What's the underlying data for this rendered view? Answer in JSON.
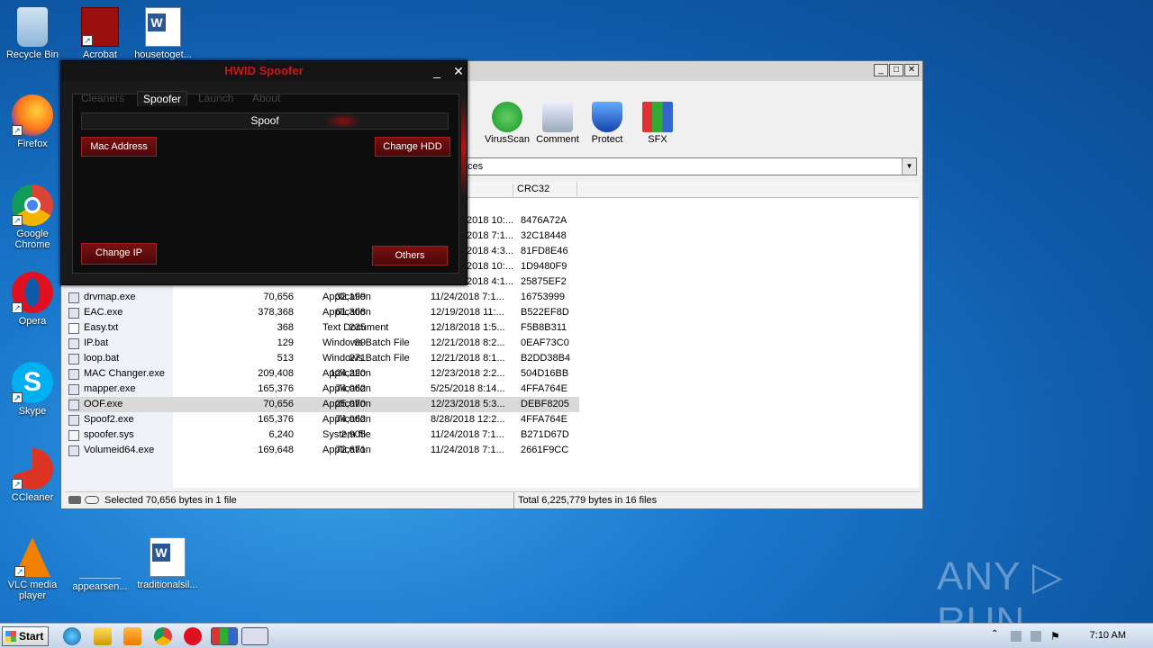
{
  "desktop": {
    "icons": [
      {
        "label": "Recycle Bin"
      },
      {
        "label": "Acrobat"
      },
      {
        "label": "housetoget..."
      },
      {
        "label": "Firefox"
      },
      {
        "label": "Google Chrome"
      },
      {
        "label": "Opera"
      },
      {
        "label": "Skype"
      },
      {
        "label": "CCleaner"
      },
      {
        "label": "VLC media player"
      },
      {
        "label": "appearsen..."
      },
      {
        "label": "traditionalsil..."
      }
    ]
  },
  "winrar": {
    "toolbar": [
      "VirusScan",
      "Comment",
      "Protect",
      "SFX"
    ],
    "path_value": "ces",
    "columns": {
      "crc": "CRC32"
    },
    "partial_rows": [
      {
        "modified": "2018 10:...",
        "crc": "8476A72A"
      },
      {
        "modified": "2018 7:1...",
        "crc": "32C18448"
      },
      {
        "modified": "2018 4:3...",
        "crc": "81FD8E46"
      },
      {
        "modified": "2018 10:...",
        "crc": "1D9480F9"
      },
      {
        "modified": "2018 4:1...",
        "crc": "25875EF2"
      }
    ],
    "rows": [
      {
        "name": "drvmap.exe",
        "size": "70,656",
        "packed": "32,199",
        "type": "Application",
        "modified": "11/24/2018 7:1...",
        "crc": "16753999"
      },
      {
        "name": "EAC.exe",
        "size": "378,368",
        "packed": "61,308",
        "type": "Application",
        "modified": "12/19/2018 11:...",
        "crc": "B522EF8D"
      },
      {
        "name": "Easy.txt",
        "size": "368",
        "packed": "235",
        "type": "Text Document",
        "modified": "12/18/2018 1:5...",
        "crc": "F5B8B311"
      },
      {
        "name": "IP.bat",
        "size": "129",
        "packed": "99",
        "type": "Windows Batch File",
        "modified": "12/21/2018 8:2...",
        "crc": "0EAF73C0"
      },
      {
        "name": "loop.bat",
        "size": "513",
        "packed": "271",
        "type": "Windows Batch File",
        "modified": "12/21/2018 8:1...",
        "crc": "B2DD38B4"
      },
      {
        "name": "MAC Changer.exe",
        "size": "209,408",
        "packed": "124,220",
        "type": "Application",
        "modified": "12/23/2018 2:2...",
        "crc": "504D16BB"
      },
      {
        "name": "mapper.exe",
        "size": "165,376",
        "packed": "74,062",
        "type": "Application",
        "modified": "5/25/2018 8:14...",
        "crc": "4FFA764E"
      },
      {
        "name": "OOF.exe",
        "size": "70,656",
        "packed": "25,070",
        "type": "Application",
        "modified": "12/23/2018 5:3...",
        "crc": "DEBF8205"
      },
      {
        "name": "Spoof2.exe",
        "size": "165,376",
        "packed": "74,062",
        "type": "Application",
        "modified": "8/28/2018 12:2...",
        "crc": "4FFA764E"
      },
      {
        "name": "spoofer.sys",
        "size": "6,240",
        "packed": "2,905",
        "type": "System file",
        "modified": "11/24/2018 7:1...",
        "crc": "B271D67D"
      },
      {
        "name": "Volumeid64.exe",
        "size": "169,648",
        "packed": "72,671",
        "type": "Application",
        "modified": "11/24/2018 7:1...",
        "crc": "2661F9CC"
      }
    ],
    "status_left": "Selected 70,656 bytes in 1 file",
    "status_right": "Total 6,225,779 bytes in 16 files"
  },
  "spoofer": {
    "title": "HWID Spoofer",
    "tabs": [
      "Cleaners",
      "Spoofer",
      "Launch",
      "About"
    ],
    "spoof_label": "Spoof",
    "buttons": {
      "mac": "Mac Address",
      "hdd": "Change HDD",
      "ip": "Change IP",
      "others": "Others"
    },
    "close": "✕",
    "minimize": "_"
  },
  "taskbar": {
    "start": "Start",
    "clock": "7:10 AM"
  },
  "watermark": "ANY ▷ RUN"
}
